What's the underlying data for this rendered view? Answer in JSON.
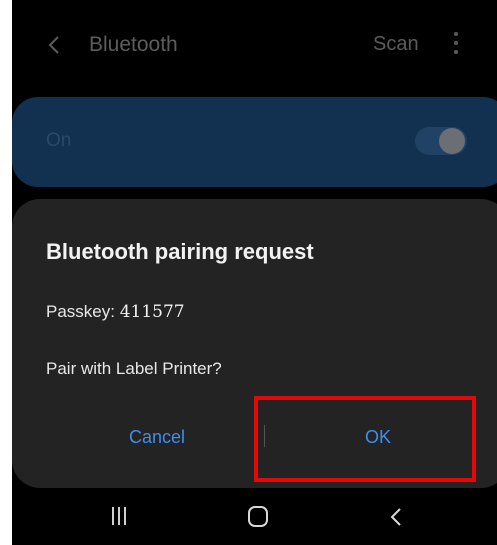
{
  "header": {
    "title": "Bluetooth",
    "scan_label": "Scan"
  },
  "bluetooth_toggle": {
    "label": "On",
    "state": "on"
  },
  "dialog": {
    "title": "Bluetooth pairing request",
    "passkey_label": "Passkey: ",
    "passkey_value": "411577",
    "question": "Pair with Label Printer?",
    "cancel_label": "Cancel",
    "ok_label": "OK"
  },
  "colors": {
    "accent": "#3e8ef0",
    "highlight_border": "#e4080a",
    "dialog_bg": "#232323"
  },
  "navbar": {
    "icons": [
      "recent-apps-icon",
      "home-icon",
      "back-icon"
    ]
  }
}
